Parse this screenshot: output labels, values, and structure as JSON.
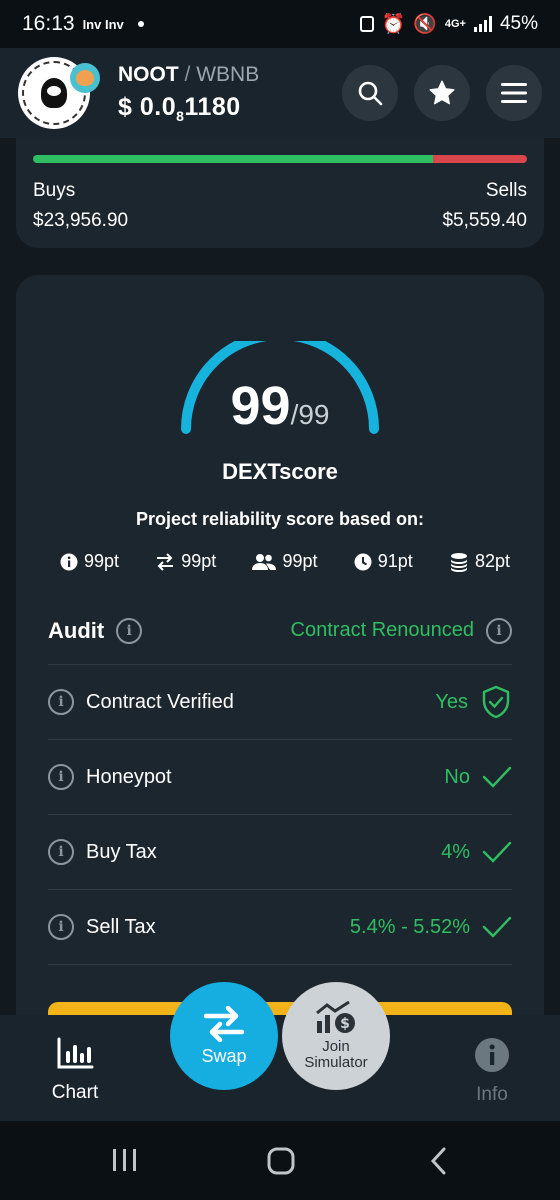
{
  "status_bar": {
    "time": "16:13",
    "notifications": "Inv Inv",
    "network": "4G+",
    "battery": "45%"
  },
  "header": {
    "base_token": "NOOT",
    "separator": "/",
    "quote_token": "WBNB",
    "price_prefix": "$ 0.0",
    "price_zeros": "8",
    "price_digits": "1180"
  },
  "trades": {
    "buys_label": "Buys",
    "buys_value": "$23,956.90",
    "sells_label": "Sells",
    "sells_value": "$5,559.40",
    "buy_ratio": 0.81,
    "colors": {
      "buy": "#2fbe61",
      "sell": "#d9464c"
    }
  },
  "score": {
    "value": "99",
    "max": "/99",
    "fill_fraction": 1.0,
    "title": "DEXTscore",
    "subtitle": "Project reliability score based on:",
    "components": [
      {
        "icon": "info-icon",
        "value": "99pt"
      },
      {
        "icon": "transfer-icon",
        "value": "99pt"
      },
      {
        "icon": "users-icon",
        "value": "99pt"
      },
      {
        "icon": "clock-icon",
        "value": "91pt"
      },
      {
        "icon": "coins-icon",
        "value": "82pt"
      }
    ]
  },
  "audit": {
    "title": "Audit",
    "status": "Contract Renounced",
    "rows": [
      {
        "label": "Contract Verified",
        "value": "Yes",
        "icon": "shield-check-icon"
      },
      {
        "label": "Honeypot",
        "value": "No",
        "icon": "check-icon"
      },
      {
        "label": "Buy Tax",
        "value": "4%",
        "icon": "check-icon"
      },
      {
        "label": "Sell Tax",
        "value": "5.4% - 5.52%",
        "icon": "check-icon"
      }
    ]
  },
  "bottom_nav": {
    "chart": "Chart",
    "swap": "Swap",
    "simulator_line1": "Join",
    "simulator_line2": "Simulator",
    "info": "Info"
  },
  "colors": {
    "accent": "#16aee0",
    "positive": "#2fbe61",
    "negative": "#d9464c",
    "warning": "#f2b318"
  }
}
